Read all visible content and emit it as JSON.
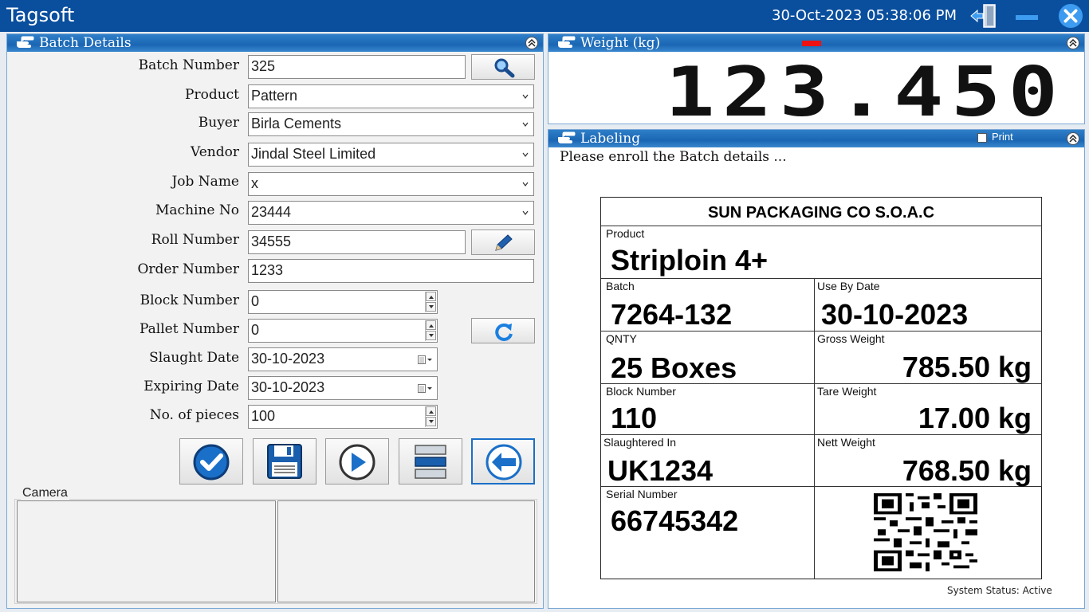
{
  "titlebar": {
    "app_title": "Tagsoft",
    "datetime": "30-Oct-2023 05:38:06 PM",
    "icons": [
      "exit-door-icon",
      "minimize-icon",
      "close-icon"
    ],
    "accent_color": "#0a4f9e"
  },
  "batch_panel": {
    "title": "Batch Details",
    "fields": {
      "batch_number": {
        "label": "Batch Number",
        "value": "325"
      },
      "product": {
        "label": "Product",
        "value": "Pattern"
      },
      "buyer": {
        "label": "Buyer",
        "value": "Birla Cements"
      },
      "vendor": {
        "label": "Vendor",
        "value": "Jindal Steel Limited"
      },
      "job_name": {
        "label": "Job Name",
        "value": "x"
      },
      "machine_no": {
        "label": "Machine No",
        "value": "23444"
      },
      "roll_number": {
        "label": "Roll Number",
        "value": "34555"
      },
      "order_number": {
        "label": "Order Number",
        "value": "1233"
      },
      "block_number": {
        "label": "Block Number",
        "value": "0"
      },
      "pallet_number": {
        "label": "Pallet Number",
        "value": "0"
      },
      "slaught_date": {
        "label": "Slaught Date",
        "value": "30-10-2023"
      },
      "expiring_date": {
        "label": "Expiring Date",
        "value": "30-10-2023"
      },
      "no_of_pieces": {
        "label": "No. of pieces",
        "value": "100"
      }
    },
    "action_icons": [
      "check-icon",
      "save-icon",
      "play-icon",
      "list-icon",
      "back-arrow-icon"
    ],
    "camera_label": "Camera"
  },
  "weight_panel": {
    "title": "Weight (kg)",
    "value": "123.450"
  },
  "labeling_panel": {
    "title": "Labeling",
    "print_label": "Print",
    "print_checked": false,
    "message": "Please enroll the Batch details ...",
    "ticket": {
      "company": "SUN PACKAGING CO S.O.A.C",
      "product_label": "Product",
      "product_value": "Striploin 4+",
      "batch_label": "Batch",
      "batch_value": "7264-132",
      "use_by_label": "Use By Date",
      "use_by_value": "30-10-2023",
      "qnty_label": "QNTY",
      "qnty_value": "25 Boxes",
      "gross_label": "Gross Weight",
      "gross_value": "785.50 kg",
      "block_label": "Block Number",
      "block_value": "110",
      "tare_label": "Tare Weight",
      "tare_value": "17.00 kg",
      "slaughtered_label": "Slaughtered In",
      "slaughtered_value": "UK1234",
      "nett_label": "Nett Weight",
      "nett_value": "768.50 kg",
      "serial_label": "Serial Number",
      "serial_value": "66745342"
    }
  },
  "status": "System Status: Active"
}
